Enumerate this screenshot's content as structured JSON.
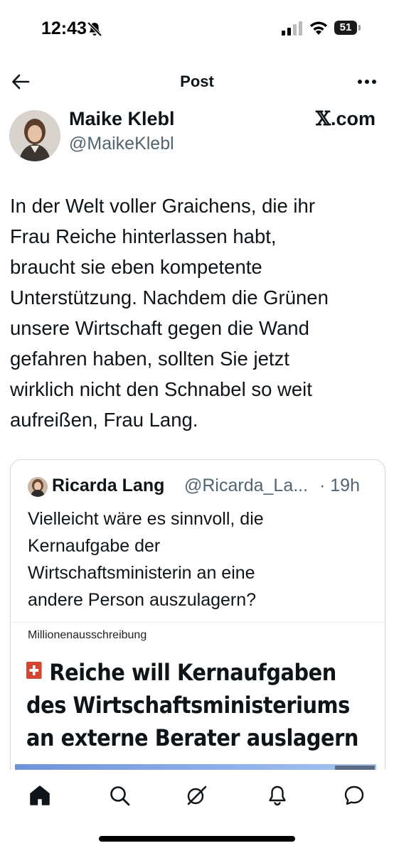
{
  "status_bar": {
    "time": "12:43",
    "battery": "51",
    "icons": [
      "bell-muted-icon",
      "signal-icon",
      "wifi-icon",
      "battery-icon"
    ]
  },
  "header": {
    "title": "Post",
    "icons": [
      "back-arrow-icon",
      "more-options-icon"
    ]
  },
  "post": {
    "author_name": "Maike Klebl",
    "author_handle": "@MaikeKlebl",
    "source": ".com",
    "source_glyph": "𝕏",
    "text_lines": [
      "In der Welt voller Graichens, die ihr",
      "Frau Reiche hinterlassen habt,",
      "braucht sie eben kompetente",
      "Unterstützung. Nachdem die Grünen",
      "unsere Wirtschaft gegen die Wand",
      "gefahren haben, sollten Sie jetzt",
      "wirklich nicht den Schnabel so weit",
      "aufreißen, Frau Lang."
    ]
  },
  "quoted_post": {
    "author_name": "Ricarda Lang",
    "author_handle": "@Ricarda_La...",
    "time": "· 19h",
    "text_lines": [
      "Vielleicht wäre es sinnvoll, die",
      "Kernaufgabe der",
      "Wirtschaftsministerin an eine",
      "andere Person auszulagern?"
    ],
    "article": {
      "kicker": "Millionenausschreibung",
      "headline_lines": [
        "Reiche will Kernaufgaben",
        "des Wirtschaftsministeriums",
        "an externe Berater auslagern"
      ],
      "badge_color": "#d6452f"
    }
  },
  "bottom_nav": {
    "items": [
      "home-icon",
      "search-icon",
      "grok-icon",
      "notifications-icon",
      "messages-icon"
    ]
  },
  "colors": {
    "text": "#0f1419",
    "secondary_text": "#536471",
    "border": "#cfd9de",
    "background": "#ffffff"
  }
}
